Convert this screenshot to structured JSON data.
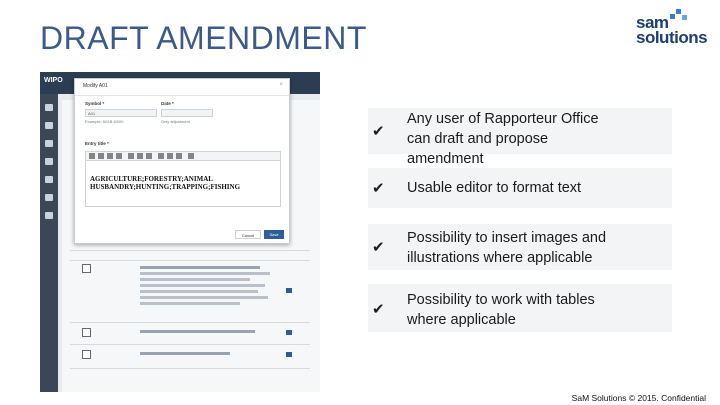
{
  "slide": {
    "title": "DRAFT AMENDMENT",
    "logo_line1": "sam",
    "logo_line2": "solutions",
    "footer": "SaM Solutions © 2015. Confidential"
  },
  "bullets": [
    {
      "icon": "check-icon",
      "text_lines": [
        "Any user of Rapporteur Office",
        "can draft and propose",
        "amendment"
      ]
    },
    {
      "icon": "check-icon",
      "text_lines": [
        "Usable editor to format text"
      ]
    },
    {
      "icon": "check-icon",
      "text_lines": [
        "Possibility to insert images and",
        "illustrations where applicable"
      ]
    },
    {
      "icon": "check-icon",
      "text_lines": [
        "Possibility to work with tables",
        "where applicable"
      ]
    }
  ],
  "screenshot": {
    "app_name": "WIPO",
    "modal": {
      "title": "Modify A01",
      "symbol_label": "Symbol *",
      "symbol_value": "A01",
      "symbol_hint": "Example: A01B 63/00",
      "date_label": "Date *",
      "date_hint": "Only adjustment",
      "entry_title_label": "Entry title *",
      "editor_text_line1": "AGRICULTURE;FORESTRY;ANIMAL",
      "editor_text_line2": "HUSBANDRY;HUNTING;TRAPPING;FISHING",
      "cancel_label": "Cancel",
      "save_label": "Save"
    }
  }
}
